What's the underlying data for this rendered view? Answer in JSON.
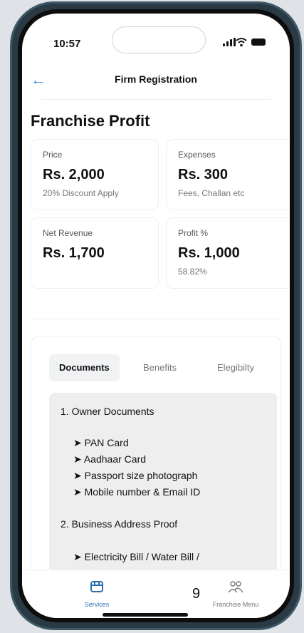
{
  "status_bar": {
    "time": "10:57"
  },
  "header": {
    "back_glyph": "←",
    "title": "Firm Registration"
  },
  "section": {
    "title": "Franchise Profit"
  },
  "cards": [
    {
      "label": "Price",
      "value": "Rs. 2,000",
      "sub": "20% Discount Apply"
    },
    {
      "label": "Expenses",
      "value": "Rs. 300",
      "sub": "Fees, Challan etc"
    },
    {
      "label": "Net Revenue",
      "value": "Rs. 1,700",
      "sub": ""
    },
    {
      "label": "Profit %",
      "value": "Rs. 1,000",
      "sub": "58.82%"
    }
  ],
  "tabs": [
    {
      "label": "Documents",
      "active": true
    },
    {
      "label": "Benefits",
      "active": false
    },
    {
      "label": "Elegibilty",
      "active": false
    }
  ],
  "documents": {
    "heading1": "1. Owner Documents",
    "items1": [
      "➤ PAN Card",
      "➤ Aadhaar Card",
      "➤ Passport size photograph",
      "➤ Mobile number & Email ID"
    ],
    "heading2": "2. Business Address Proof",
    "items2": [
      "➤ Electricity Bill / Water Bill /"
    ]
  },
  "bottom_nav": [
    {
      "label": "Services",
      "icon": "store-icon",
      "active": true
    },
    {
      "label": "Franchise Menu",
      "icon": "users-icon",
      "active": false
    }
  ],
  "page_number": "9",
  "colors": {
    "accent": "#3b8ed8",
    "active_nav": "#2f6fb0",
    "doc_bg": "#eeeeee"
  }
}
